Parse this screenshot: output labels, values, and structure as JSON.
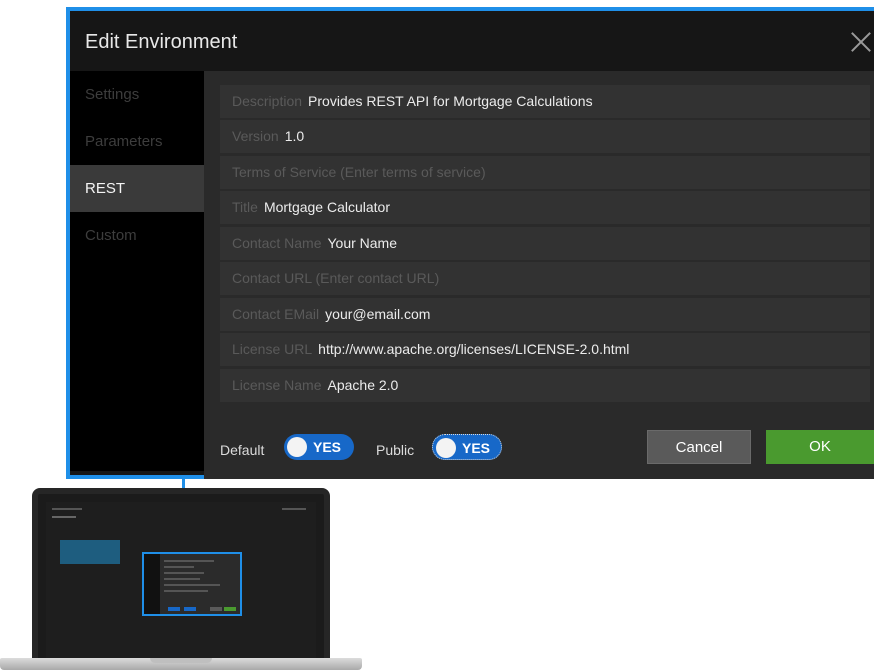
{
  "dialog": {
    "title": "Edit Environment",
    "sidebar": [
      {
        "label": "Settings",
        "active": false
      },
      {
        "label": "Parameters",
        "active": false
      },
      {
        "label": "REST",
        "active": true
      },
      {
        "label": "Custom",
        "active": false
      }
    ],
    "fields": [
      {
        "label": "Description",
        "value": "Provides REST API for Mortgage Calculations"
      },
      {
        "label": "Version",
        "value": "1.0"
      },
      {
        "label": "Terms of Service (Enter terms of service)",
        "value": ""
      },
      {
        "label": "Title",
        "value": "Mortgage Calculator"
      },
      {
        "label": "Contact Name",
        "value": "Your Name"
      },
      {
        "label": "Contact URL (Enter contact URL)",
        "value": ""
      },
      {
        "label": "Contact EMail",
        "value": "your@email.com"
      },
      {
        "label": "License URL",
        "value": "http://www.apache.org/licenses/LICENSE-2.0.html"
      },
      {
        "label": "License Name",
        "value": "Apache 2.0"
      }
    ],
    "footer": {
      "default_label": "Default",
      "default_toggle": "YES",
      "public_label": "Public",
      "public_toggle": "YES",
      "cancel_label": "Cancel",
      "ok_label": "OK"
    }
  },
  "colors": {
    "accent_blue": "#1f8fe8",
    "toggle_blue": "#1768c8",
    "ok_green": "#4a9a2f",
    "dialog_bg": "#161616"
  },
  "icons": {
    "close": "close-icon",
    "laptop": "laptop-icon"
  }
}
